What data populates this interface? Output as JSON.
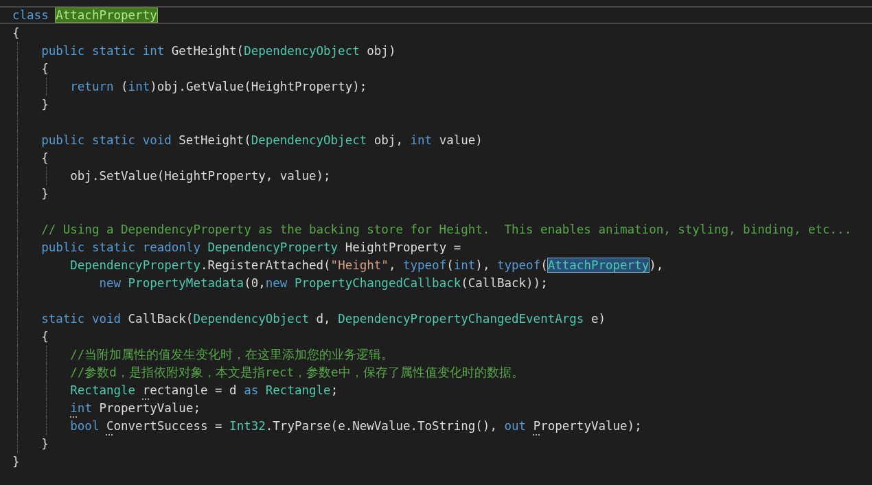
{
  "editor": {
    "lines": [
      {
        "current": true,
        "tokens": [
          {
            "text": "class ",
            "kind": "keyword"
          },
          {
            "text": "AttachProperty",
            "kind": "reference"
          }
        ]
      },
      {
        "tokens": [
          {
            "text": "{",
            "kind": "plain"
          }
        ]
      },
      {
        "tokens": [
          {
            "text": "    public static int ",
            "kind": "keyword"
          },
          {
            "text": "GetHeight(",
            "kind": "plain"
          },
          {
            "text": "DependencyObject",
            "kind": "type"
          },
          {
            "text": " obj)",
            "kind": "plain"
          }
        ]
      },
      {
        "tokens": [
          {
            "text": "    {",
            "kind": "plain"
          }
        ]
      },
      {
        "tokens": [
          {
            "text": "        return ",
            "kind": "keyword"
          },
          {
            "text": "(",
            "kind": "plain"
          },
          {
            "text": "int",
            "kind": "keyword"
          },
          {
            "text": ")obj.GetValue(HeightProperty);",
            "kind": "plain"
          }
        ]
      },
      {
        "tokens": [
          {
            "text": "    }",
            "kind": "plain"
          }
        ]
      },
      {
        "blank": true
      },
      {
        "tokens": [
          {
            "text": "    public static void ",
            "kind": "keyword"
          },
          {
            "text": "SetHeight(",
            "kind": "plain"
          },
          {
            "text": "DependencyObject",
            "kind": "type"
          },
          {
            "text": " obj, ",
            "kind": "plain"
          },
          {
            "text": "int",
            "kind": "keyword"
          },
          {
            "text": " value)",
            "kind": "plain"
          }
        ]
      },
      {
        "tokens": [
          {
            "text": "    {",
            "kind": "plain"
          }
        ]
      },
      {
        "tokens": [
          {
            "text": "        obj.SetValue(HeightProperty, value);",
            "kind": "plain"
          }
        ]
      },
      {
        "tokens": [
          {
            "text": "    }",
            "kind": "plain"
          }
        ]
      },
      {
        "blank": true
      },
      {
        "tokens": [
          {
            "text": "    // Using a DependencyProperty as the backing store for Height.  This enables animation, styling, binding, etc...",
            "kind": "comment"
          }
        ]
      },
      {
        "tokens": [
          {
            "text": "    public static readonly ",
            "kind": "keyword"
          },
          {
            "text": "DependencyProperty",
            "kind": "type"
          },
          {
            "text": " HeightProperty =",
            "kind": "plain"
          }
        ]
      },
      {
        "tokens": [
          {
            "text": "        DependencyProperty",
            "kind": "type"
          },
          {
            "text": ".RegisterAttached(",
            "kind": "plain"
          },
          {
            "text": "\"Height\"",
            "kind": "string"
          },
          {
            "text": ", ",
            "kind": "plain"
          },
          {
            "text": "typeof",
            "kind": "keyword"
          },
          {
            "text": "(",
            "kind": "plain"
          },
          {
            "text": "int",
            "kind": "keyword"
          },
          {
            "text": "), ",
            "kind": "plain"
          },
          {
            "text": "typeof",
            "kind": "keyword"
          },
          {
            "text": "(",
            "kind": "plain"
          },
          {
            "text": "AttachProperty",
            "kind": "selection"
          },
          {
            "text": "),",
            "kind": "plain"
          }
        ]
      },
      {
        "tokens": [
          {
            "text": "            new ",
            "kind": "keyword"
          },
          {
            "text": "PropertyMetadata",
            "kind": "type"
          },
          {
            "text": "(0,",
            "kind": "plain"
          },
          {
            "text": "new ",
            "kind": "keyword"
          },
          {
            "text": "PropertyChangedCallback",
            "kind": "type"
          },
          {
            "text": "(CallBack));",
            "kind": "plain"
          }
        ]
      },
      {
        "blank": true
      },
      {
        "tokens": [
          {
            "text": "    static void ",
            "kind": "keyword"
          },
          {
            "text": "CallBack(",
            "kind": "plain"
          },
          {
            "text": "DependencyObject",
            "kind": "type"
          },
          {
            "text": " d, ",
            "kind": "plain"
          },
          {
            "text": "DependencyPropertyChangedEventArgs",
            "kind": "type"
          },
          {
            "text": " e)",
            "kind": "plain"
          }
        ]
      },
      {
        "tokens": [
          {
            "text": "    {",
            "kind": "plain"
          }
        ]
      },
      {
        "tokens": [
          {
            "text": "        //当附加属性的值发生变化时，在这里添加您的业务逻辑。",
            "kind": "comment"
          }
        ]
      },
      {
        "tokens": [
          {
            "text": "        //参数d，是指依附对象，本文是指rect，参数e中，保存了属性值变化时的数据。",
            "kind": "comment"
          }
        ]
      },
      {
        "tokens": [
          {
            "text": "        Rectangle",
            "kind": "type"
          },
          {
            "text": " rectangle = d ",
            "kind": "plain",
            "hint": true
          },
          {
            "text": "as ",
            "kind": "keyword"
          },
          {
            "text": "Rectangle",
            "kind": "type"
          },
          {
            "text": ";",
            "kind": "plain"
          }
        ]
      },
      {
        "tokens": [
          {
            "text": "        int",
            "kind": "keyword",
            "hint": true
          },
          {
            "text": " PropertyValue;",
            "kind": "plain"
          }
        ]
      },
      {
        "tokens": [
          {
            "text": "        bool ",
            "kind": "keyword"
          },
          {
            "text": "ConvertSuccess = ",
            "kind": "plain",
            "hint": true
          },
          {
            "text": "Int32",
            "kind": "type"
          },
          {
            "text": ".TryParse(e.NewValue.ToString(), ",
            "kind": "plain"
          },
          {
            "text": "out ",
            "kind": "keyword"
          },
          {
            "text": "PropertyValue);",
            "kind": "plain",
            "hint": true
          }
        ]
      },
      {
        "tokens": [
          {
            "text": "    }",
            "kind": "plain"
          }
        ]
      },
      {
        "tokens": [
          {
            "text": "}",
            "kind": "plain"
          }
        ]
      }
    ]
  }
}
